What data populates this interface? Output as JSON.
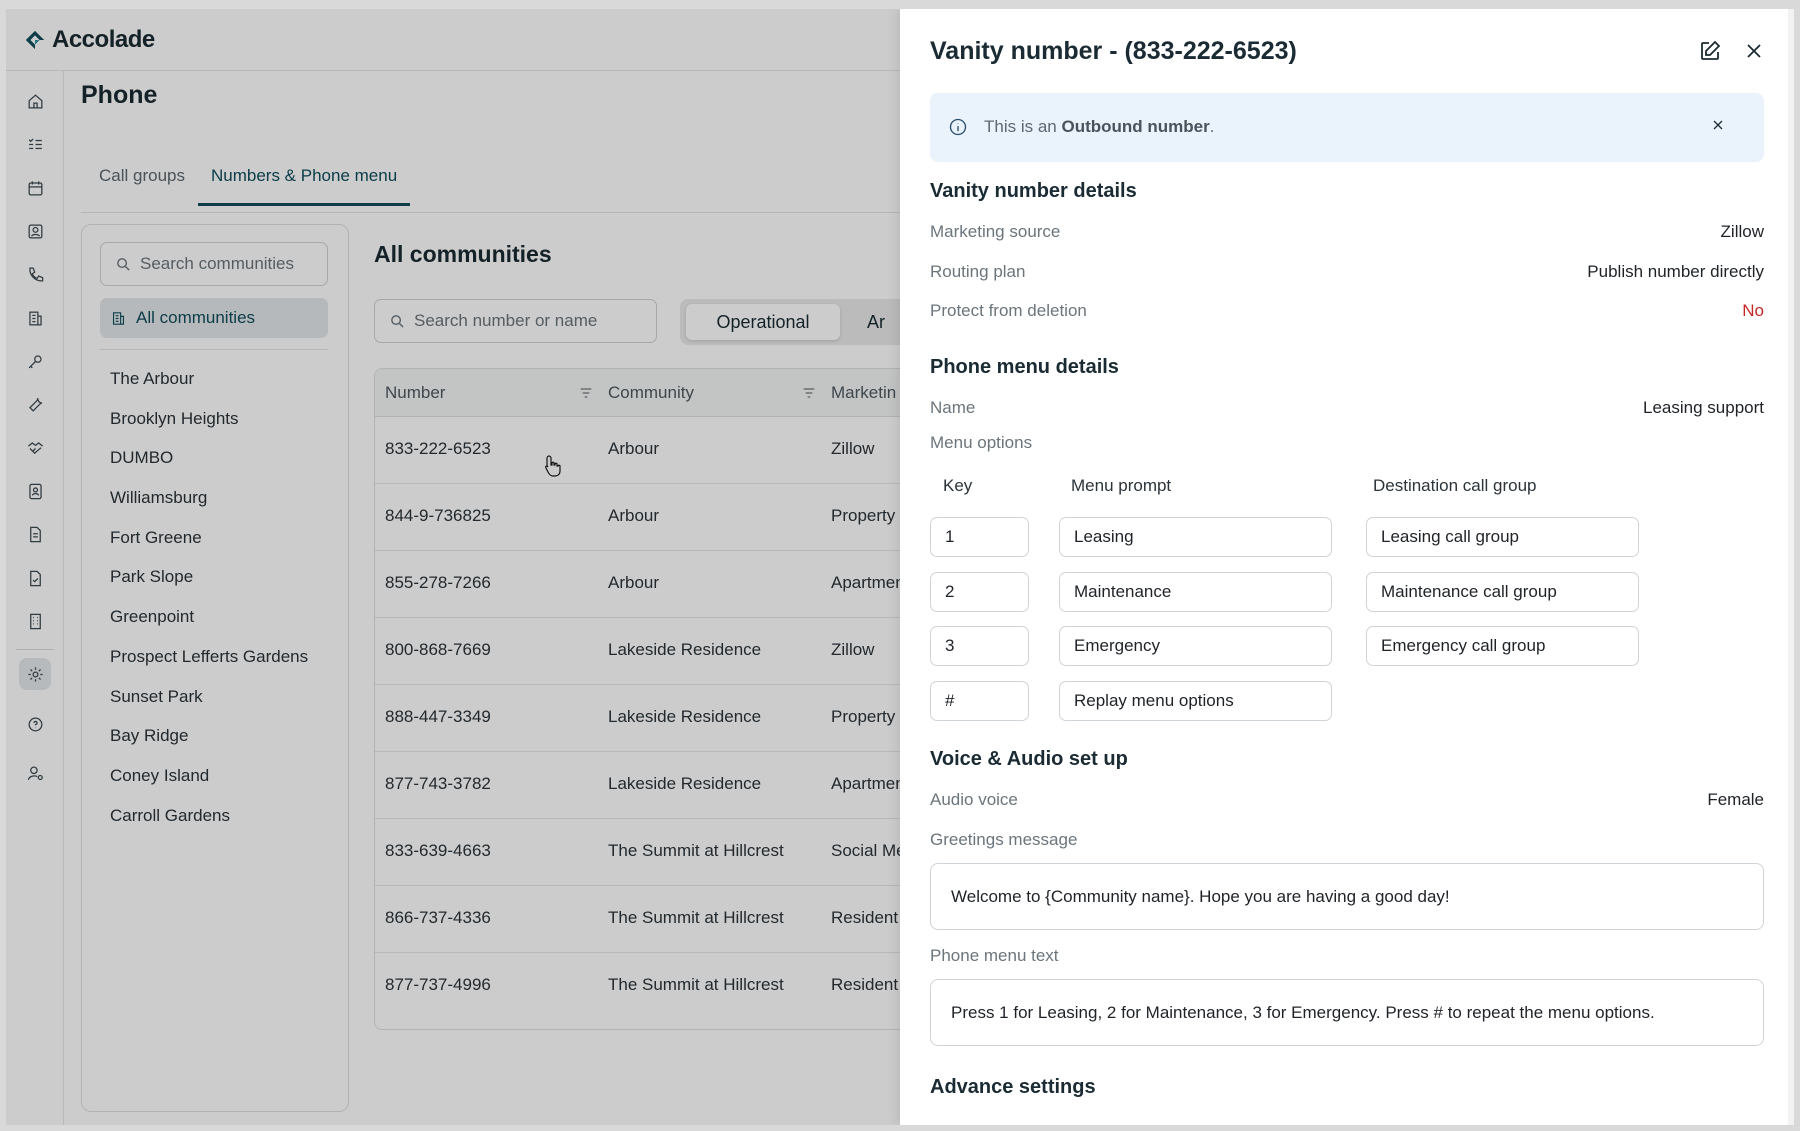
{
  "app": {
    "brand": "Accolade",
    "page_title": "Phone",
    "tabs": [
      {
        "label": "Call groups"
      },
      {
        "label": "Numbers & Phone menu"
      }
    ]
  },
  "communities": {
    "search_placeholder": "Search communities",
    "all_label": "All communities",
    "items": [
      "The Arbour",
      "Brooklyn Heights",
      "DUMBO",
      "Williamsburg",
      "Fort Greene",
      "Park Slope",
      "Greenpoint",
      "Prospect Lefferts Gardens",
      "Sunset Park",
      "Bay Ridge",
      "Coney Island",
      "Carroll Gardens"
    ]
  },
  "main": {
    "title": "All communities",
    "search_placeholder": "Search number or name",
    "segment_operational": "Operational",
    "segment_second": "Ar",
    "columns": [
      "Number",
      "Community",
      "Marketin"
    ],
    "rows": [
      {
        "number": "833-222-6523",
        "community": "Arbour",
        "marketing": "Zillow"
      },
      {
        "number": "844-9-736825",
        "community": "Arbour",
        "marketing": "Property"
      },
      {
        "number": "855-278-7266",
        "community": "Arbour",
        "marketing": "Apartmen"
      },
      {
        "number": "800-868-7669",
        "community": "Lakeside Residence",
        "marketing": "Zillow"
      },
      {
        "number": "888-447-3349",
        "community": "Lakeside Residence",
        "marketing": "Property"
      },
      {
        "number": "877-743-3782",
        "community": "Lakeside Residence",
        "marketing": "Apartmen"
      },
      {
        "number": "833-639-4663",
        "community": "The Summit at Hillcrest",
        "marketing": "Social Me"
      },
      {
        "number": "866-737-4336",
        "community": "The Summit at Hillcrest",
        "marketing": "Resident"
      },
      {
        "number": "877-737-4996",
        "community": "The Summit at Hillcrest",
        "marketing": "Resident"
      }
    ]
  },
  "drawer": {
    "title": "Vanity number - (833-222-6523)",
    "banner_prefix": "This is an ",
    "banner_bold": "Outbound number",
    "banner_suffix": ".",
    "details_title": "Vanity number details",
    "marketing_source_label": "Marketing source",
    "marketing_source_value": "Zillow",
    "routing_plan_label": "Routing plan",
    "routing_plan_value": "Publish number directly",
    "protect_label": "Protect from deletion",
    "protect_value": "No",
    "phone_menu_title": "Phone menu details",
    "name_label": "Name",
    "name_value": "Leasing support",
    "menu_options_label": "Menu options",
    "menu_headers": {
      "key": "Key",
      "prompt": "Menu prompt",
      "dest": "Destination call group"
    },
    "menu_rows": [
      {
        "key": "1",
        "prompt": "Leasing",
        "dest": "Leasing call group"
      },
      {
        "key": "2",
        "prompt": "Maintenance",
        "dest": "Maintenance call group"
      },
      {
        "key": "3",
        "prompt": "Emergency",
        "dest": "Emergency call group"
      },
      {
        "key": "#",
        "prompt": "Replay menu options",
        "dest": ""
      }
    ],
    "voice_title": "Voice & Audio set up",
    "audio_voice_label": "Audio voice",
    "audio_voice_value": "Female",
    "greetings_label": "Greetings message",
    "greetings_value": "Welcome to {Community name}. Hope you are having a good day!",
    "menu_text_label": "Phone menu text",
    "menu_text_value": "Press 1 for Leasing, 2 for Maintenance, 3 for Emergency. Press # to repeat the menu options.",
    "advance_title": "Advance settings"
  },
  "colors": {
    "accent": "#0f4d5c",
    "danger": "#c62828",
    "banner_bg": "#eaf3fb"
  }
}
